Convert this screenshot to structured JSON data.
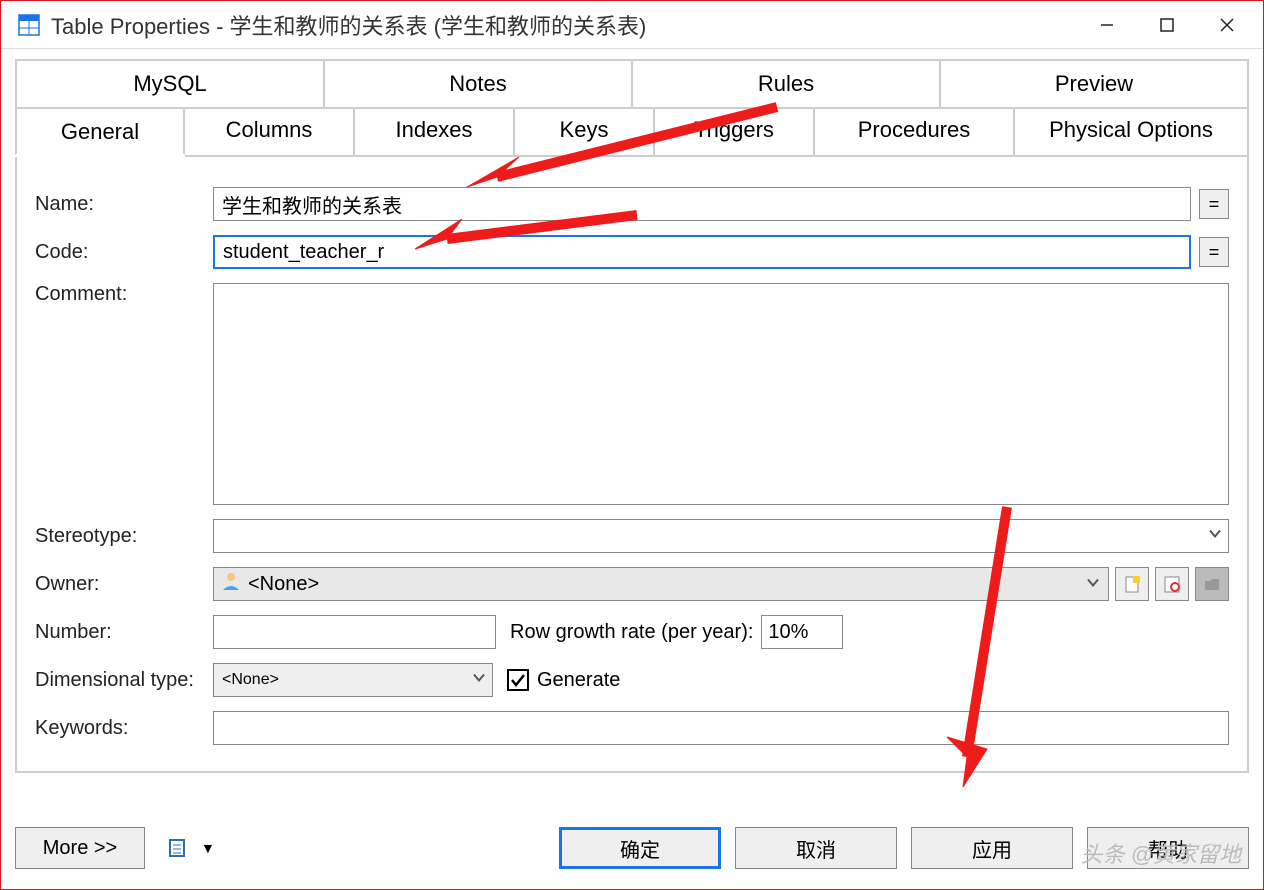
{
  "window": {
    "title": "Table Properties - 学生和教师的关系表 (学生和教师的关系表)"
  },
  "tabs_top": [
    "MySQL",
    "Notes",
    "Rules",
    "Preview"
  ],
  "tabs_bottom": [
    "General",
    "Columns",
    "Indexes",
    "Keys",
    "Triggers",
    "Procedures",
    "Physical Options"
  ],
  "labels": {
    "name": "Name:",
    "code": "Code:",
    "comment": "Comment:",
    "stereotype": "Stereotype:",
    "owner": "Owner:",
    "number": "Number:",
    "row_growth": "Row growth rate (per year):",
    "dim_type": "Dimensional type:",
    "generate": "Generate",
    "keywords": "Keywords:"
  },
  "values": {
    "name": "学生和教师的关系表",
    "code": "student_teacher_r",
    "comment": "",
    "stereotype": "",
    "owner": "<None>",
    "number": "",
    "row_growth": "10%",
    "dim_type": "<None>",
    "generate_checked": true,
    "keywords": ""
  },
  "buttons": {
    "eq": "=",
    "more": "More >>",
    "ok": "确定",
    "cancel": "取消",
    "apply": "应用",
    "help": "帮助"
  },
  "watermark": "头条 @黄家留地"
}
